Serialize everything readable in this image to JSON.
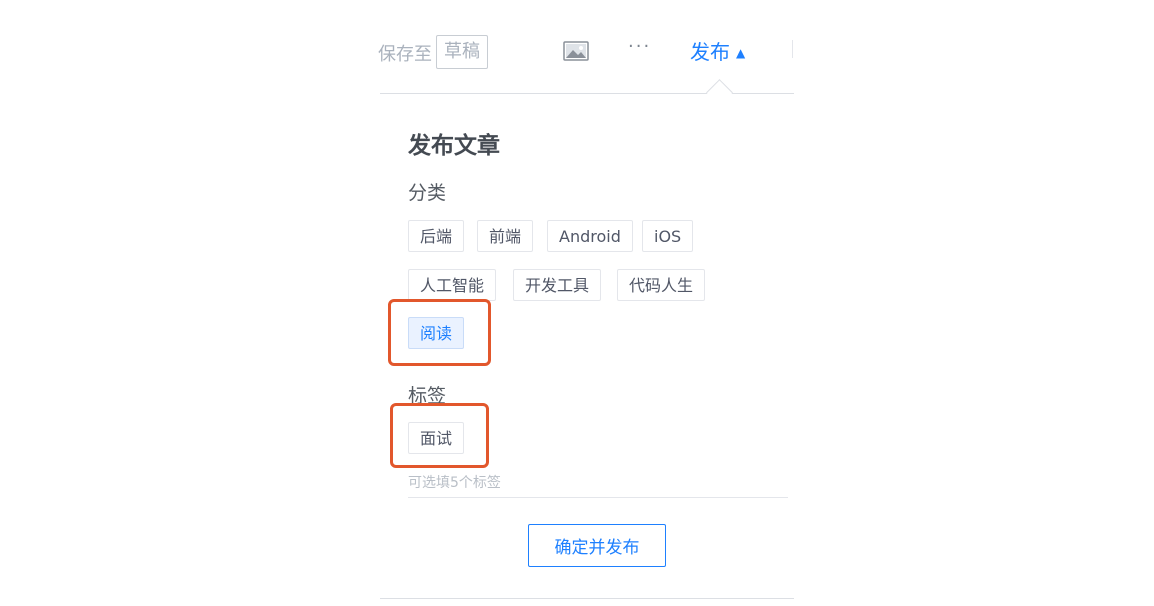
{
  "header": {
    "autosave_text": "保存至",
    "draft_label": "草稿",
    "image_icon": "image-icon",
    "more_label": "···",
    "publish_label": "发布",
    "publish_caret": "▲"
  },
  "publish_panel": {
    "title": "发布文章",
    "category": {
      "label": "分类",
      "items": [
        "后端",
        "前端",
        "Android",
        "iOS",
        "人工智能",
        "开发工具",
        "代码人生",
        "阅读"
      ],
      "selected": "阅读"
    },
    "tags": {
      "label": "标签",
      "items": [
        "面试"
      ],
      "input_placeholder": "可选填5个标签"
    },
    "confirm_label": "确定并发布"
  },
  "colors": {
    "accent": "#1e80ff",
    "highlight": "#e2572c",
    "muted_text": "#aab2bd"
  }
}
